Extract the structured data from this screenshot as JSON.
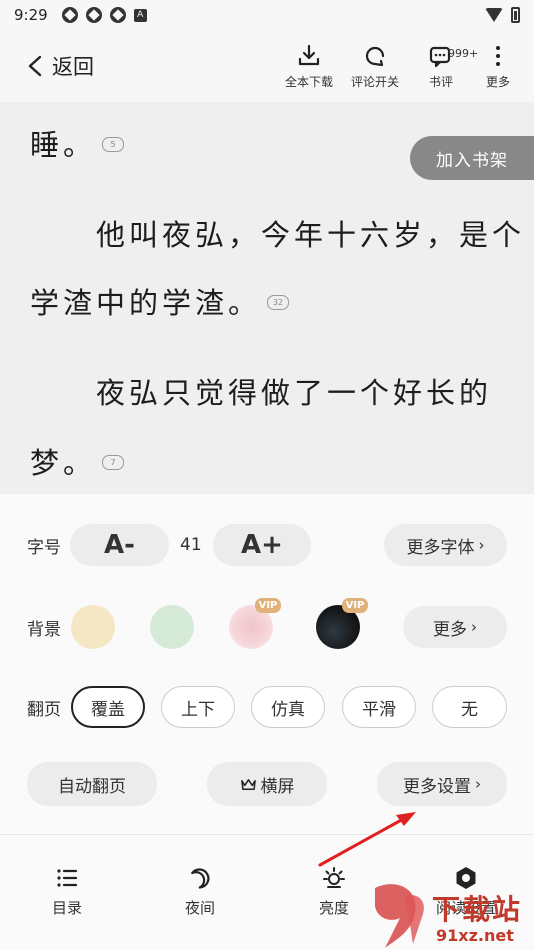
{
  "status_bar": {
    "time": "9:29"
  },
  "top_bar": {
    "back_label": "返回",
    "actions": [
      {
        "label": "全本下载",
        "icon": "download-icon"
      },
      {
        "label": "评论开关",
        "icon": "comment-toggle-icon"
      },
      {
        "label": "书评",
        "icon": "book-review-icon",
        "badge": "999+"
      },
      {
        "label": "更多",
        "icon": "more-vertical-icon"
      }
    ]
  },
  "reading": {
    "add_shelf_label": "加入书架",
    "paragraphs": [
      {
        "text": "睡。",
        "comments": "5"
      },
      {
        "text": "　　他叫夜弘，今年十六岁，是个"
      },
      {
        "text": "学渣中的学渣。",
        "comments": "32"
      },
      {
        "text": "　　夜弘只觉得做了一个好长的"
      },
      {
        "text": "梦。",
        "comments": "7"
      }
    ]
  },
  "settings": {
    "font_size": {
      "label": "字号",
      "decrease_label": "A-",
      "value": "41",
      "increase_label": "A+",
      "more_fonts_label": "更多字体"
    },
    "background": {
      "label": "背景",
      "vip_label": "VIP",
      "more_label": "更多",
      "colors": [
        "#f5e6c4",
        "#d4ead6",
        "#f6d8dc",
        "#1a1a1a"
      ]
    },
    "page_turn": {
      "label": "翻页",
      "options": [
        "覆盖",
        "上下",
        "仿真",
        "平滑",
        "无"
      ],
      "selected": "覆盖"
    },
    "extras": {
      "auto_turn_label": "自动翻页",
      "landscape_label": "横屏",
      "more_settings_label": "更多设置"
    }
  },
  "bottom_nav": [
    {
      "label": "目录",
      "icon": "toc-list-icon"
    },
    {
      "label": "夜间",
      "icon": "night-moon-icon"
    },
    {
      "label": "亮度",
      "icon": "brightness-icon"
    },
    {
      "label": "阅读设置",
      "icon": "settings-gear-icon"
    }
  ],
  "watermark": {
    "text": "下载站",
    "url": "91xz.net"
  },
  "colors": {
    "accent_dark": "#222222",
    "pill_bg": "#ececec",
    "vip": "#e0b27a",
    "annotation_arrow": "#e02020"
  }
}
